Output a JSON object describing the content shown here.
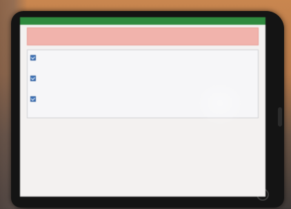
{
  "app_bar": {
    "title": "",
    "user_menu": ""
  },
  "alert": {
    "text": ""
  },
  "section": {
    "label": ""
  },
  "options": [
    {
      "text": ""
    },
    {
      "text": ""
    },
    {
      "text": ""
    }
  ],
  "colors": {
    "app_bar": "#2f8a3e",
    "alert_bg": "#f1b3ac",
    "option_icon": "#3c72b8"
  },
  "icons": {
    "option": "checkbox-icon",
    "home": "home-button-icon"
  }
}
